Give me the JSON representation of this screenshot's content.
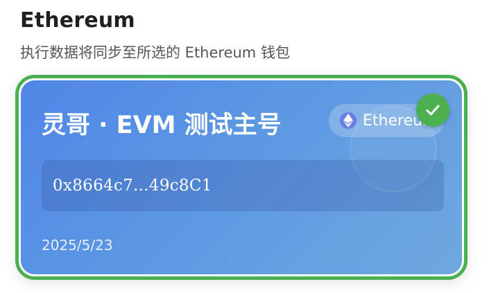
{
  "header": {
    "title": "Ethereum",
    "subtitle": "执行数据将同步至所选的 Ethereum 钱包"
  },
  "wallet_card": {
    "name": "灵哥 · EVM 测试主号",
    "network": {
      "label": "Ethereum",
      "icon": "ethereum-icon"
    },
    "address": "0x8664c7...49c8C1",
    "date": "2025/5/23",
    "selected": true,
    "selected_icon": "checkmark-icon"
  },
  "colors": {
    "selected_border": "#4caf50",
    "card_gradient_start": "#4f86e6",
    "card_gradient_end": "#6fa8de",
    "check_badge": "#4caf50",
    "eth_icon_bg": "#6b7ce6"
  }
}
